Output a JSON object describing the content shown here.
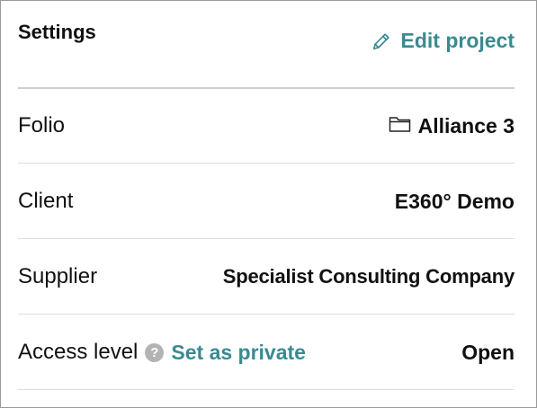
{
  "settings": {
    "title": "Settings",
    "edit_link": {
      "label": "Edit project",
      "icon": "pencil-icon"
    },
    "accent_color": "#3a8a90",
    "rows": {
      "folio": {
        "label": "Folio",
        "value": "Alliance 3",
        "icon": "folder-icon"
      },
      "client": {
        "label": "Client",
        "value": "E360° Demo"
      },
      "supplier": {
        "label": "Supplier",
        "value": "Specialist Consulting Company"
      },
      "access": {
        "label": "Access level",
        "help_glyph": "?",
        "action_label": "Set as private",
        "value": "Open"
      }
    }
  }
}
